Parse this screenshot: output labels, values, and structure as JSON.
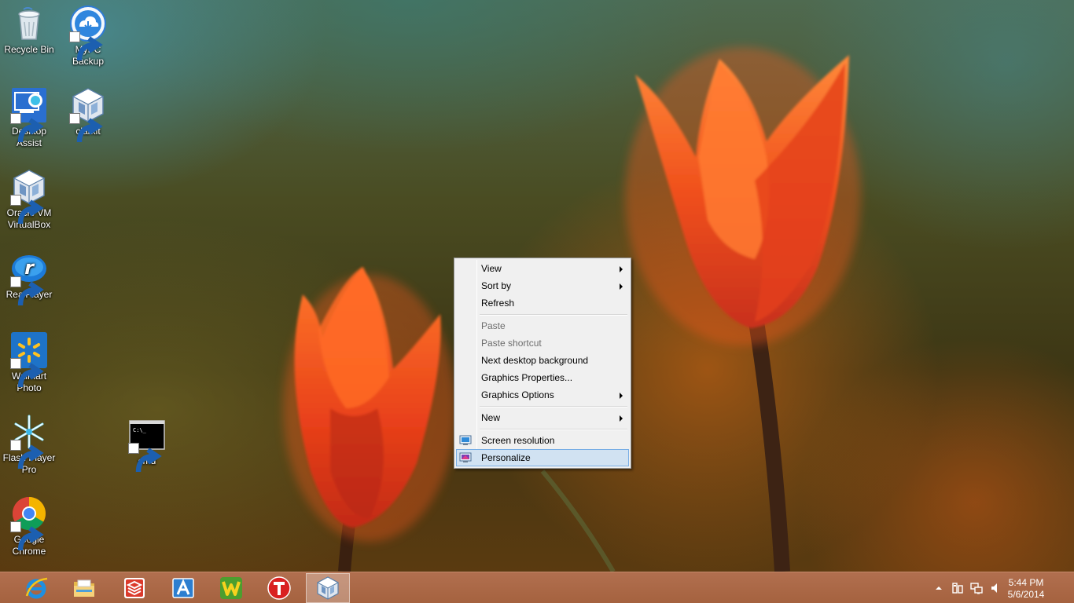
{
  "desktop": {
    "icons": [
      {
        "label": "Recycle Bin",
        "icon": "recycle-bin-icon"
      },
      {
        "label": "MyPC Backup",
        "icon": "mypc-backup-icon"
      },
      {
        "label": "Desktop Assist",
        "icon": "desktop-assist-icon"
      },
      {
        "label": "clarkit",
        "icon": "virtualbox-icon"
      },
      {
        "label": "Oracle VM VirtualBox",
        "icon": "virtualbox-icon"
      },
      {
        "label": "RealPlayer",
        "icon": "realplayer-icon"
      },
      {
        "label": "Walmart Photo",
        "icon": "walmart-photo-icon"
      },
      {
        "label": "Flash Player Pro",
        "icon": "flash-player-pro-icon"
      },
      {
        "label": "cmd",
        "icon": "cmd-icon"
      },
      {
        "label": "Google Chrome",
        "icon": "chrome-icon"
      }
    ]
  },
  "context_menu": {
    "items": [
      {
        "label": "View",
        "submenu": true,
        "disabled": false
      },
      {
        "label": "Sort by",
        "submenu": true,
        "disabled": false
      },
      {
        "label": "Refresh",
        "submenu": false,
        "disabled": false
      },
      {
        "label": "Paste",
        "submenu": false,
        "disabled": true
      },
      {
        "label": "Paste shortcut",
        "submenu": false,
        "disabled": true
      },
      {
        "label": "Next desktop background",
        "submenu": false,
        "disabled": false
      },
      {
        "label": "Graphics Properties...",
        "submenu": false,
        "disabled": false
      },
      {
        "label": "Graphics Options",
        "submenu": true,
        "disabled": false
      },
      {
        "label": "New",
        "submenu": true,
        "disabled": false
      },
      {
        "label": "Screen resolution",
        "submenu": false,
        "disabled": false,
        "icon": "screen-resolution-icon"
      },
      {
        "label": "Personalize",
        "submenu": false,
        "disabled": false,
        "icon": "personalize-icon",
        "highlighted": true
      }
    ]
  },
  "taskbar": {
    "pinned": [
      {
        "icon": "internet-explorer-icon"
      },
      {
        "icon": "file-explorer-icon"
      },
      {
        "icon": "todoist-icon"
      },
      {
        "icon": "a-app-icon"
      },
      {
        "icon": "w-app-icon"
      },
      {
        "icon": "t-app-icon"
      },
      {
        "icon": "virtualbox-icon",
        "active": true
      }
    ],
    "tray": {
      "icons": [
        "show-hidden-icons-icon",
        "action-center-icon",
        "network-icon",
        "volume-icon"
      ],
      "time": "5:44 PM",
      "date": "5/6/2014"
    }
  },
  "colors": {
    "taskbar": "#a86644",
    "menu_highlight": "#d1e2f2",
    "menu_highlight_border": "#78aee5"
  }
}
